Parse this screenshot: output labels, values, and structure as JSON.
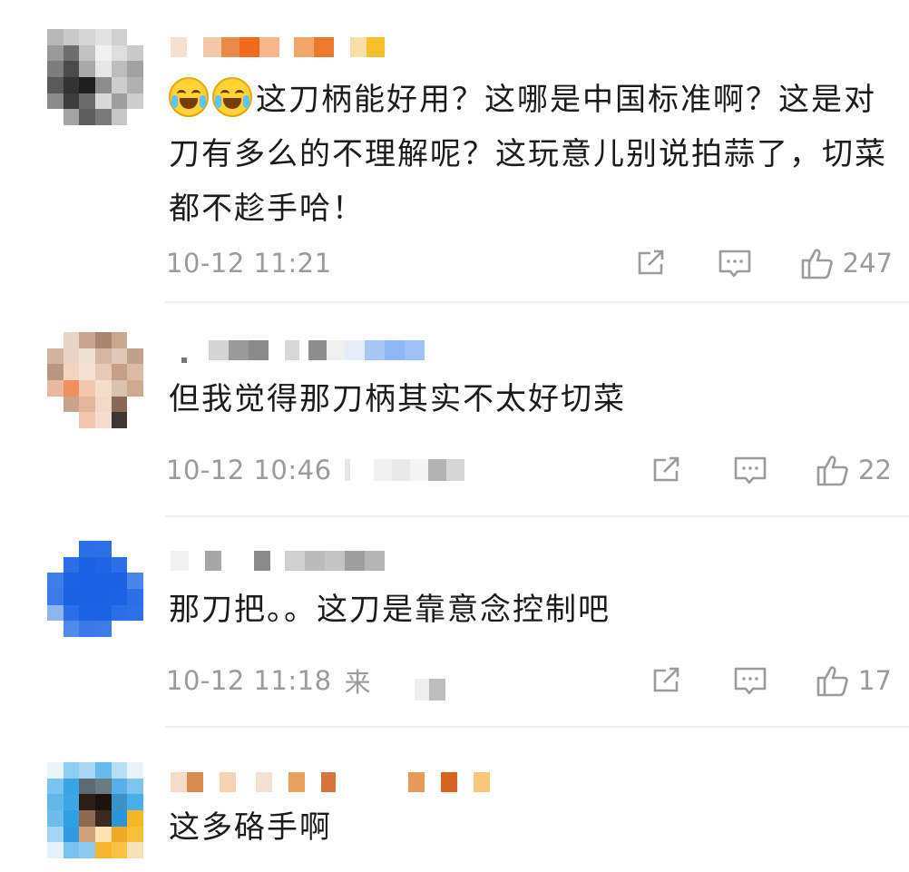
{
  "comments": [
    {
      "text": "这刀柄能好用？这哪是中国标准啊？这是对刀有多么的不理解呢？这玩意儿别说拍蒜了，切菜都不趁手哈！",
      "time": "10-12 11:21",
      "source": "",
      "likes": "247",
      "has_emoji": true
    },
    {
      "text": "但我觉得那刀柄其实不太好切菜",
      "time": "10-12 10:46",
      "source": "",
      "likes": "22"
    },
    {
      "text": "那刀把。。这刀是靠意念控制吧",
      "time": "10-12 11:18",
      "source": "来",
      "likes": "17"
    },
    {
      "text": "这多硌手啊",
      "time": "",
      "source": "",
      "likes": ""
    }
  ],
  "icons": {
    "share": "share-icon",
    "reply": "comment-icon",
    "like": "thumbs-up-icon",
    "emoji": "laughing-crying-emoji-icon"
  },
  "colors": {
    "text": "#1b1b1b",
    "meta": "#9b9b9b",
    "divider": "#eeeeee"
  }
}
